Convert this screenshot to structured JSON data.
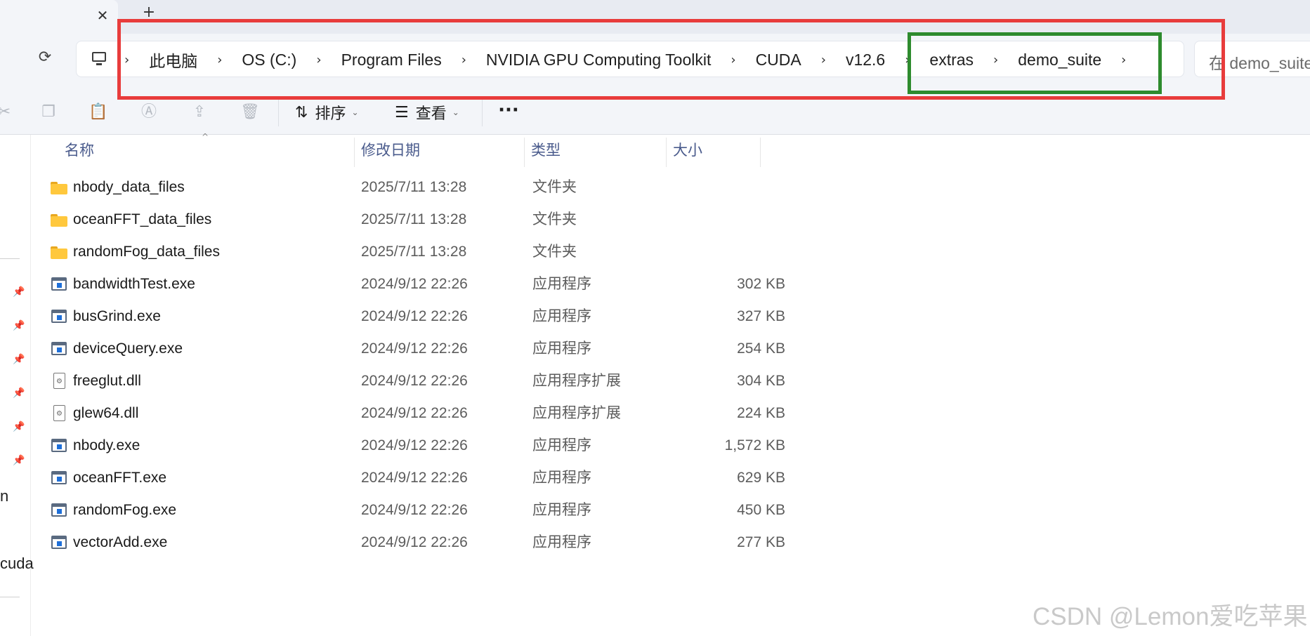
{
  "tabs": {
    "close_glyph": "✕",
    "new_tab_glyph": "+"
  },
  "address_bar": {
    "refresh_glyph": "⟳",
    "chevron": "›",
    "breadcrumbs": [
      "此电脑",
      "OS (C:)",
      "Program Files",
      "NVIDIA GPU Computing Toolkit",
      "CUDA",
      "v12.6",
      "extras",
      "demo_suite"
    ],
    "search_text": "在 demo_suite 中搜索"
  },
  "toolbar": {
    "sort_label": "排序",
    "view_label": "查看",
    "more_glyph": "···",
    "disabled_icons": [
      "cut-icon",
      "copy-icon",
      "paste-icon",
      "rename-icon",
      "share-icon",
      "delete-icon"
    ]
  },
  "nav_pane": {
    "fragments": [
      "n",
      "cuda"
    ]
  },
  "columns": {
    "name": "名称",
    "date": "修改日期",
    "type": "类型",
    "size": "大小"
  },
  "files": [
    {
      "name": "nbody_data_files",
      "date": "2025/7/11 13:28",
      "type": "文件夹",
      "size": "",
      "icon": "folder"
    },
    {
      "name": "oceanFFT_data_files",
      "date": "2025/7/11 13:28",
      "type": "文件夹",
      "size": "",
      "icon": "folder"
    },
    {
      "name": "randomFog_data_files",
      "date": "2025/7/11 13:28",
      "type": "文件夹",
      "size": "",
      "icon": "folder"
    },
    {
      "name": "bandwidthTest.exe",
      "date": "2024/9/12 22:26",
      "type": "应用程序",
      "size": "302 KB",
      "icon": "exe"
    },
    {
      "name": "busGrind.exe",
      "date": "2024/9/12 22:26",
      "type": "应用程序",
      "size": "327 KB",
      "icon": "exe"
    },
    {
      "name": "deviceQuery.exe",
      "date": "2024/9/12 22:26",
      "type": "应用程序",
      "size": "254 KB",
      "icon": "exe"
    },
    {
      "name": "freeglut.dll",
      "date": "2024/9/12 22:26",
      "type": "应用程序扩展",
      "size": "304 KB",
      "icon": "dll"
    },
    {
      "name": "glew64.dll",
      "date": "2024/9/12 22:26",
      "type": "应用程序扩展",
      "size": "224 KB",
      "icon": "dll"
    },
    {
      "name": "nbody.exe",
      "date": "2024/9/12 22:26",
      "type": "应用程序",
      "size": "1,572 KB",
      "icon": "exe"
    },
    {
      "name": "oceanFFT.exe",
      "date": "2024/9/12 22:26",
      "type": "应用程序",
      "size": "629 KB",
      "icon": "exe"
    },
    {
      "name": "randomFog.exe",
      "date": "2024/9/12 22:26",
      "type": "应用程序",
      "size": "450 KB",
      "icon": "exe"
    },
    {
      "name": "vectorAdd.exe",
      "date": "2024/9/12 22:26",
      "type": "应用程序",
      "size": "277 KB",
      "icon": "exe"
    }
  ],
  "annotations": {
    "outer_highlight_color": "#e83c3c",
    "inner_highlight_color": "#2e8b2e"
  },
  "watermark": "CSDN @Lemon爱吃苹果"
}
